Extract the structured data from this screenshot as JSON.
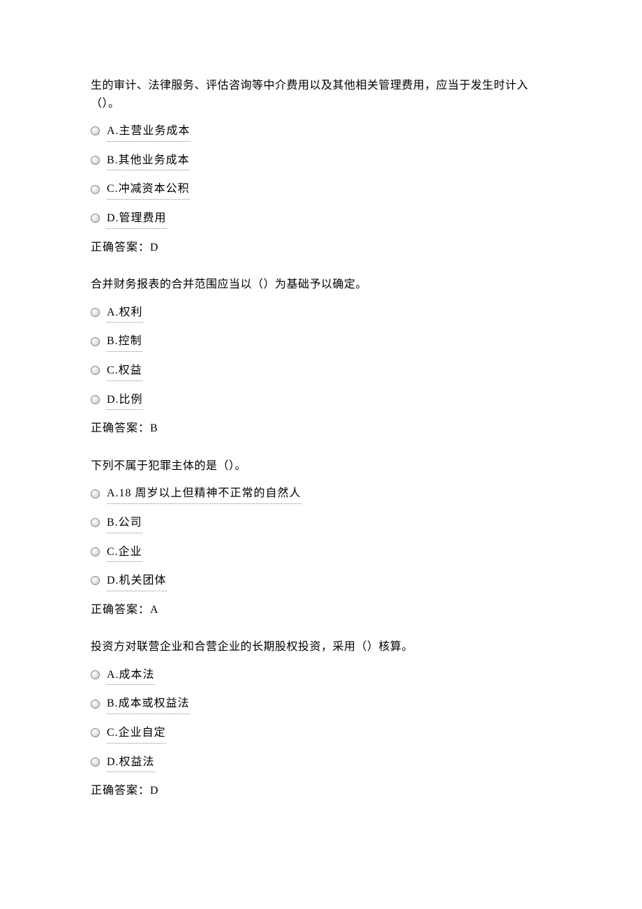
{
  "questions": [
    {
      "text": "生的审计、法律服务、评估咨询等中介费用以及其他相关管理费用，应当于发生时计入（）。",
      "options": [
        "A.主营业务成本",
        "B.其他业务成本",
        "C.冲减资本公积",
        "D.管理费用"
      ],
      "answer": "正确答案：D"
    },
    {
      "text": "合并财务报表的合并范围应当以（）为基础予以确定。",
      "options": [
        "A.权利",
        "B.控制",
        "C.权益",
        "D.比例"
      ],
      "answer": "正确答案：B"
    },
    {
      "text": "下列不属于犯罪主体的是（）。",
      "options": [
        "A.18 周岁以上但精神不正常的自然人",
        "B.公司",
        "C.企业",
        "D.机关团体"
      ],
      "answer": "正确答案：A"
    },
    {
      "text": "投资方对联营企业和合营企业的长期股权投资，采用（）核算。",
      "options": [
        "A.成本法",
        "B.成本或权益法",
        "C.企业自定",
        "D.权益法"
      ],
      "answer": "正确答案：D"
    }
  ]
}
